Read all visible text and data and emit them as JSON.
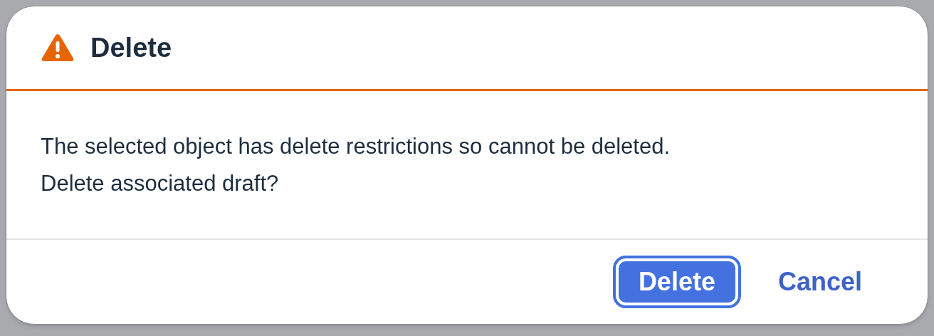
{
  "dialog": {
    "kind": "warning",
    "title": "Delete",
    "message": [
      "The selected object has delete restrictions so cannot be deleted.",
      "Delete associated draft?"
    ],
    "buttons": [
      {
        "label": "Delete",
        "kind": "emphasized",
        "focused": true
      },
      {
        "label": "Cancel",
        "kind": "transparent",
        "focused": false
      }
    ]
  }
}
